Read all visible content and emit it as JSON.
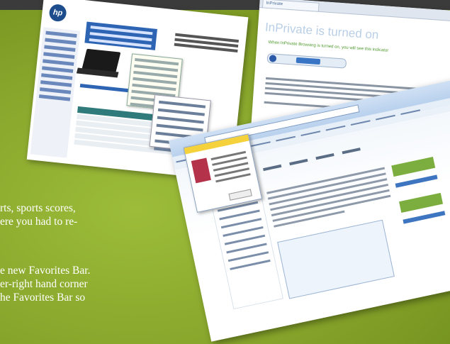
{
  "screenshots": {
    "hp_page": {
      "logo_text": "hp"
    },
    "inprivate": {
      "tab_label": "InPrivate",
      "title": "InPrivate is turned on",
      "subtitle": "When InPrivate Browsing is turned on, you will see this indicator"
    },
    "ie_window": {}
  },
  "body_text": {
    "line1": "rts, sports scores,",
    "line2": "ere you had to re-",
    "line3": "e new Favorites Bar.",
    "line4": "er-right hand corner",
    "line5": "he Favorites Bar so"
  },
  "colors": {
    "background_green": "#8aa82e",
    "top_bar": "#3b3b3b",
    "inprivate_title": "#b9cfe6",
    "inprivate_subtitle": "#4f9a2e"
  }
}
